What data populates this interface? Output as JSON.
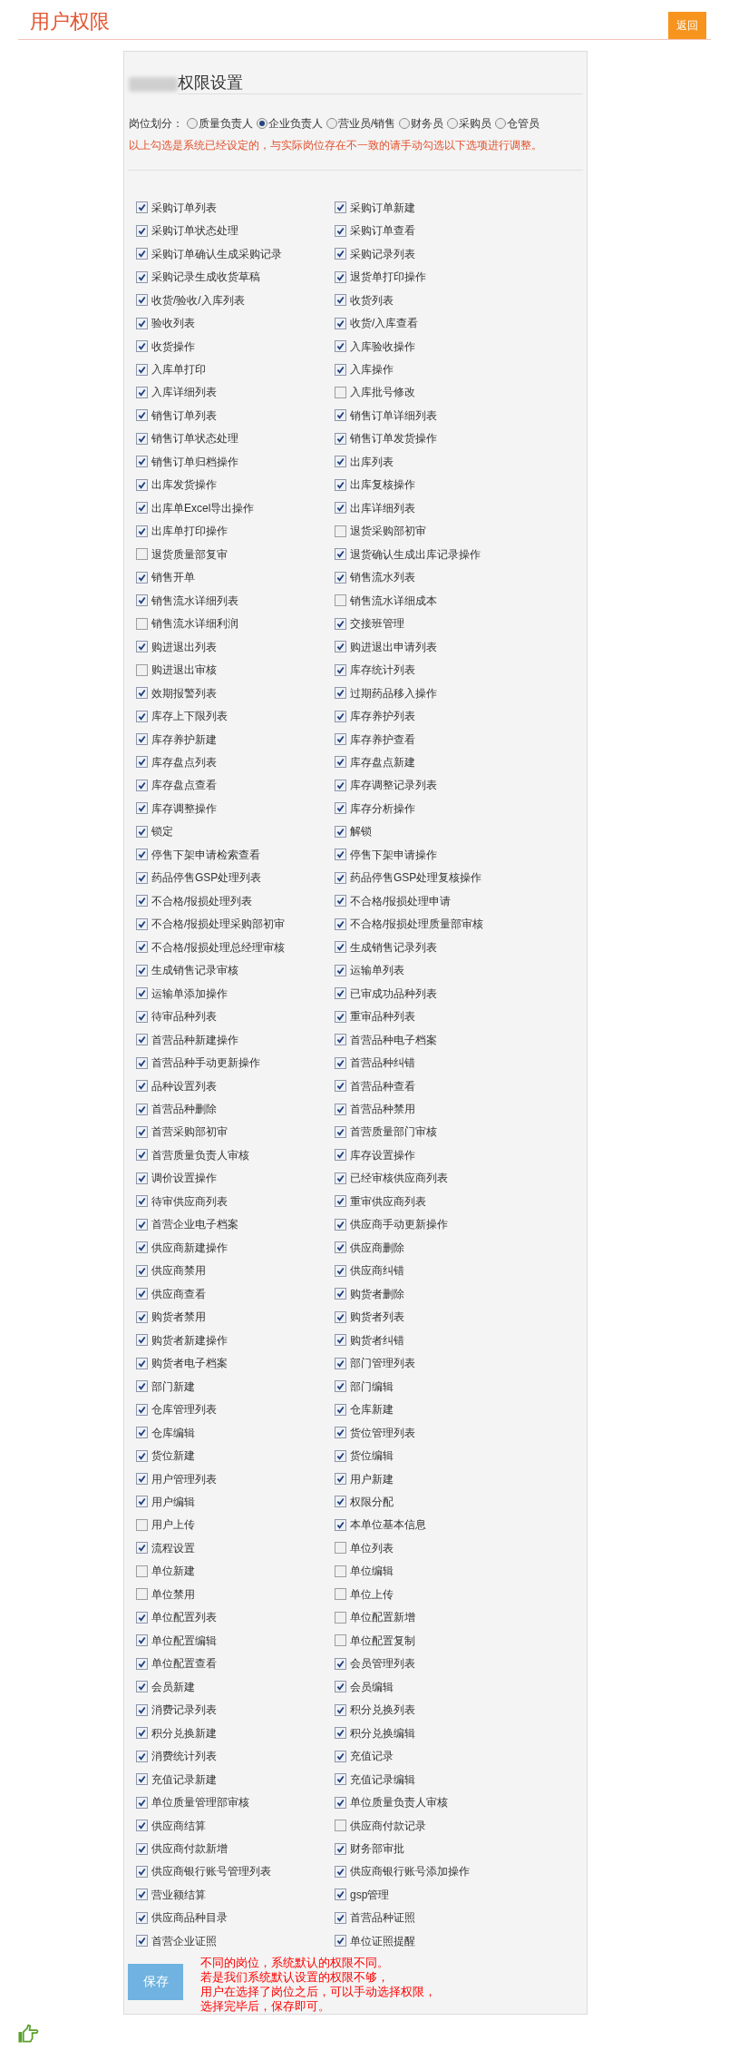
{
  "header": {
    "title": "用户权限",
    "back_button": "返回"
  },
  "panel": {
    "title": "权限设置"
  },
  "position": {
    "label": "岗位划分：",
    "options": [
      {
        "label": "质量负责人",
        "selected": false
      },
      {
        "label": "企业负责人",
        "selected": true
      },
      {
        "label": "营业员/销售",
        "selected": false
      },
      {
        "label": "财务员",
        "selected": false
      },
      {
        "label": "采购员",
        "selected": false
      },
      {
        "label": "仓管员",
        "selected": false
      }
    ]
  },
  "notice": "以上勾选是系统已经设定的，与实际岗位存在不一致的请手动勾选以下选项进行调整。",
  "permissions": [
    {
      "label": "采购订单列表",
      "checked": true
    },
    {
      "label": "采购订单新建",
      "checked": true
    },
    {
      "label": "采购订单状态处理",
      "checked": true
    },
    {
      "label": "采购订单查看",
      "checked": true
    },
    {
      "label": "采购订单确认生成采购记录",
      "checked": true
    },
    {
      "label": "采购记录列表",
      "checked": true
    },
    {
      "label": "采购记录生成收货草稿",
      "checked": true
    },
    {
      "label": "退货单打印操作",
      "checked": true
    },
    {
      "label": "收货/验收/入库列表",
      "checked": true
    },
    {
      "label": "收货列表",
      "checked": true
    },
    {
      "label": "验收列表",
      "checked": true
    },
    {
      "label": "收货/入库查看",
      "checked": true
    },
    {
      "label": "收货操作",
      "checked": true
    },
    {
      "label": "入库验收操作",
      "checked": true
    },
    {
      "label": "入库单打印",
      "checked": true
    },
    {
      "label": "入库操作",
      "checked": true
    },
    {
      "label": "入库详细列表",
      "checked": true
    },
    {
      "label": "入库批号修改",
      "checked": false
    },
    {
      "label": "销售订单列表",
      "checked": true
    },
    {
      "label": "销售订单详细列表",
      "checked": true
    },
    {
      "label": "销售订单状态处理",
      "checked": true
    },
    {
      "label": "销售订单发货操作",
      "checked": true
    },
    {
      "label": "销售订单归档操作",
      "checked": true
    },
    {
      "label": "出库列表",
      "checked": true
    },
    {
      "label": "出库发货操作",
      "checked": true
    },
    {
      "label": "出库复核操作",
      "checked": true
    },
    {
      "label": "出库单Excel导出操作",
      "checked": true
    },
    {
      "label": "出库详细列表",
      "checked": true
    },
    {
      "label": "出库单打印操作",
      "checked": true
    },
    {
      "label": "退货采购部初审",
      "checked": false
    },
    {
      "label": "退货质量部复审",
      "checked": false
    },
    {
      "label": "退货确认生成出库记录操作",
      "checked": true
    },
    {
      "label": "销售开单",
      "checked": true
    },
    {
      "label": "销售流水列表",
      "checked": true
    },
    {
      "label": "销售流水详细列表",
      "checked": true
    },
    {
      "label": "销售流水详细成本",
      "checked": false
    },
    {
      "label": "销售流水详细利润",
      "checked": false
    },
    {
      "label": "交接班管理",
      "checked": true
    },
    {
      "label": "购进退出列表",
      "checked": true
    },
    {
      "label": "购进退出申请列表",
      "checked": true
    },
    {
      "label": "购进退出审核",
      "checked": false
    },
    {
      "label": "库存统计列表",
      "checked": true
    },
    {
      "label": "效期报警列表",
      "checked": true
    },
    {
      "label": "过期药品移入操作",
      "checked": true
    },
    {
      "label": "库存上下限列表",
      "checked": true
    },
    {
      "label": "库存养护列表",
      "checked": true
    },
    {
      "label": "库存养护新建",
      "checked": true
    },
    {
      "label": "库存养护查看",
      "checked": true
    },
    {
      "label": "库存盘点列表",
      "checked": true
    },
    {
      "label": "库存盘点新建",
      "checked": true
    },
    {
      "label": "库存盘点查看",
      "checked": true
    },
    {
      "label": "库存调整记录列表",
      "checked": true
    },
    {
      "label": "库存调整操作",
      "checked": true
    },
    {
      "label": "库存分析操作",
      "checked": true
    },
    {
      "label": "锁定",
      "checked": true
    },
    {
      "label": "解锁",
      "checked": true
    },
    {
      "label": "停售下架申请检索查看",
      "checked": true
    },
    {
      "label": "停售下架申请操作",
      "checked": true
    },
    {
      "label": "药品停售GSP处理列表",
      "checked": true
    },
    {
      "label": "药品停售GSP处理复核操作",
      "checked": true
    },
    {
      "label": "不合格/报损处理列表",
      "checked": true
    },
    {
      "label": "不合格/报损处理申请",
      "checked": true
    },
    {
      "label": "不合格/报损处理采购部初审",
      "checked": true
    },
    {
      "label": "不合格/报损处理质量部审核",
      "checked": true
    },
    {
      "label": "不合格/报损处理总经理审核",
      "checked": true
    },
    {
      "label": "生成销售记录列表",
      "checked": true
    },
    {
      "label": "生成销售记录审核",
      "checked": true
    },
    {
      "label": "运输单列表",
      "checked": true
    },
    {
      "label": "运输单添加操作",
      "checked": true
    },
    {
      "label": "已审成功品种列表",
      "checked": true
    },
    {
      "label": "待审品种列表",
      "checked": true
    },
    {
      "label": "重审品种列表",
      "checked": true
    },
    {
      "label": "首营品种新建操作",
      "checked": true
    },
    {
      "label": "首营品种电子档案",
      "checked": true
    },
    {
      "label": "首营品种手动更新操作",
      "checked": true
    },
    {
      "label": "首营品种纠错",
      "checked": true
    },
    {
      "label": "品种设置列表",
      "checked": true
    },
    {
      "label": "首营品种查看",
      "checked": true
    },
    {
      "label": "首营品种删除",
      "checked": true
    },
    {
      "label": "首营品种禁用",
      "checked": true
    },
    {
      "label": "首营采购部初审",
      "checked": true
    },
    {
      "label": "首营质量部门审核",
      "checked": true
    },
    {
      "label": "首营质量负责人审核",
      "checked": true
    },
    {
      "label": "库存设置操作",
      "checked": true
    },
    {
      "label": "调价设置操作",
      "checked": true
    },
    {
      "label": "已经审核供应商列表",
      "checked": true
    },
    {
      "label": "待审供应商列表",
      "checked": true
    },
    {
      "label": "重审供应商列表",
      "checked": true
    },
    {
      "label": "首营企业电子档案",
      "checked": true
    },
    {
      "label": "供应商手动更新操作",
      "checked": true
    },
    {
      "label": "供应商新建操作",
      "checked": true
    },
    {
      "label": "供应商删除",
      "checked": true
    },
    {
      "label": "供应商禁用",
      "checked": true
    },
    {
      "label": "供应商纠错",
      "checked": true
    },
    {
      "label": "供应商查看",
      "checked": true
    },
    {
      "label": "购货者删除",
      "checked": true
    },
    {
      "label": "购货者禁用",
      "checked": true
    },
    {
      "label": "购货者列表",
      "checked": true
    },
    {
      "label": "购货者新建操作",
      "checked": true
    },
    {
      "label": "购货者纠错",
      "checked": true
    },
    {
      "label": "购货者电子档案",
      "checked": true
    },
    {
      "label": "部门管理列表",
      "checked": true
    },
    {
      "label": "部门新建",
      "checked": true
    },
    {
      "label": "部门编辑",
      "checked": true
    },
    {
      "label": "仓库管理列表",
      "checked": true
    },
    {
      "label": "仓库新建",
      "checked": true
    },
    {
      "label": "仓库编辑",
      "checked": true
    },
    {
      "label": "货位管理列表",
      "checked": true
    },
    {
      "label": "货位新建",
      "checked": true
    },
    {
      "label": "货位编辑",
      "checked": true
    },
    {
      "label": "用户管理列表",
      "checked": true
    },
    {
      "label": "用户新建",
      "checked": true
    },
    {
      "label": "用户编辑",
      "checked": true
    },
    {
      "label": "权限分配",
      "checked": true
    },
    {
      "label": "用户上传",
      "checked": false
    },
    {
      "label": "本单位基本信息",
      "checked": true
    },
    {
      "label": "流程设置",
      "checked": true
    },
    {
      "label": "单位列表",
      "checked": false
    },
    {
      "label": "单位新建",
      "checked": false
    },
    {
      "label": "单位编辑",
      "checked": false
    },
    {
      "label": "单位禁用",
      "checked": false
    },
    {
      "label": "单位上传",
      "checked": false
    },
    {
      "label": "单位配置列表",
      "checked": true
    },
    {
      "label": "单位配置新增",
      "checked": false
    },
    {
      "label": "单位配置编辑",
      "checked": true
    },
    {
      "label": "单位配置复制",
      "checked": false
    },
    {
      "label": "单位配置查看",
      "checked": true
    },
    {
      "label": "会员管理列表",
      "checked": true
    },
    {
      "label": "会员新建",
      "checked": true
    },
    {
      "label": "会员编辑",
      "checked": true
    },
    {
      "label": "消费记录列表",
      "checked": true
    },
    {
      "label": "积分兑换列表",
      "checked": true
    },
    {
      "label": "积分兑换新建",
      "checked": true
    },
    {
      "label": "积分兑换编辑",
      "checked": true
    },
    {
      "label": "消费统计列表",
      "checked": true
    },
    {
      "label": "充值记录",
      "checked": true
    },
    {
      "label": "充值记录新建",
      "checked": true
    },
    {
      "label": "充值记录编辑",
      "checked": true
    },
    {
      "label": "单位质量管理部审核",
      "checked": true
    },
    {
      "label": "单位质量负责人审核",
      "checked": true
    },
    {
      "label": "供应商结算",
      "checked": true
    },
    {
      "label": "供应商付款记录",
      "checked": false
    },
    {
      "label": "供应商付款新增",
      "checked": true
    },
    {
      "label": "财务部审批",
      "checked": true
    },
    {
      "label": "供应商银行账号管理列表",
      "checked": true
    },
    {
      "label": "供应商银行账号添加操作",
      "checked": true
    },
    {
      "label": "营业额结算",
      "checked": true
    },
    {
      "label": "gsp管理",
      "checked": true
    },
    {
      "label": "供应商品种目录",
      "checked": true
    },
    {
      "label": "首营品种证照",
      "checked": true
    },
    {
      "label": "首营企业证照",
      "checked": true
    },
    {
      "label": "单位证照提醒",
      "checked": true
    }
  ],
  "save_button": "保存",
  "annotation": [
    "不同的岗位，系统默认的权限不同。",
    "若是我们系统默认设置的权限不够，",
    "用户在选择了岗位之后，可以手动选择权限，",
    "选择完毕后，保存即可。"
  ]
}
